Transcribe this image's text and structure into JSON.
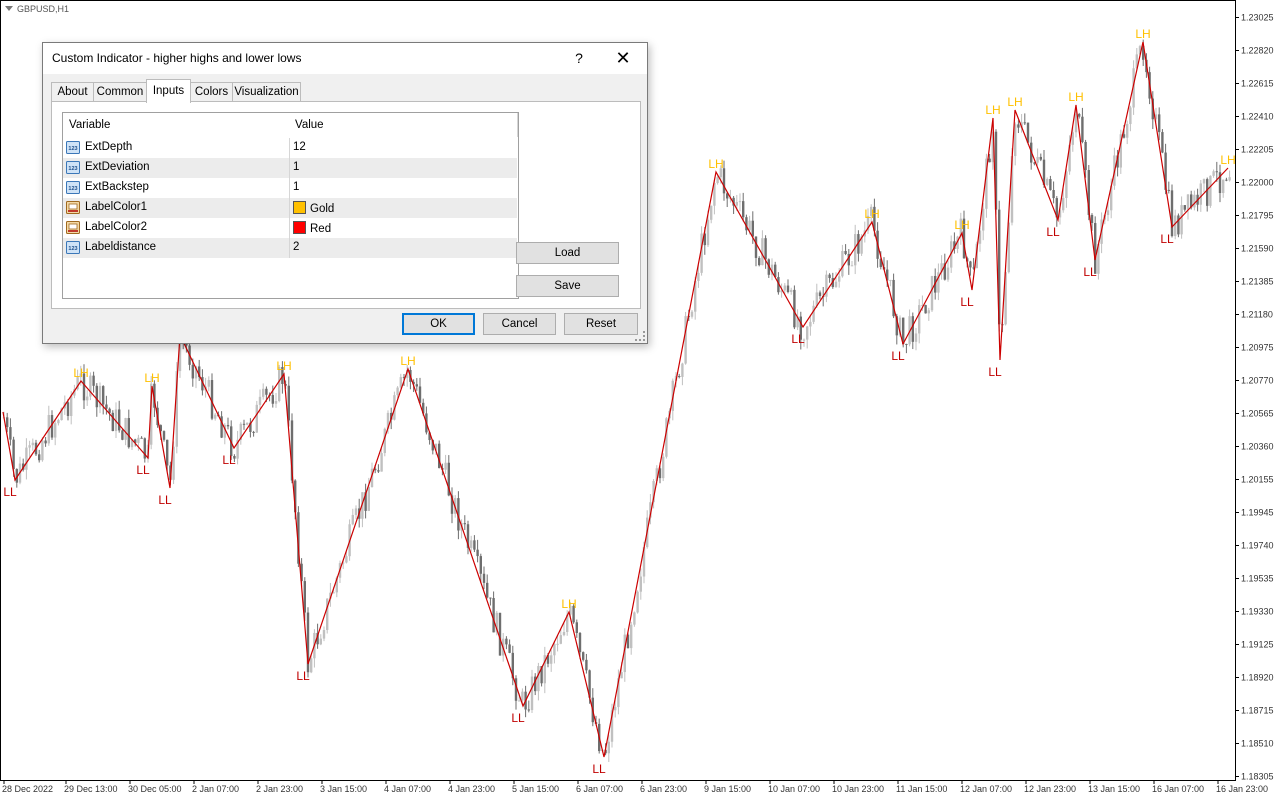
{
  "chart": {
    "symbol": "GBPUSD,H1",
    "price_levels": [
      "1.23025",
      "1.22820",
      "1.22615",
      "1.22410",
      "1.22205",
      "1.22000",
      "1.21795",
      "1.21590",
      "1.21385",
      "1.21180",
      "1.20975",
      "1.20770",
      "1.20565",
      "1.20360",
      "1.20155",
      "1.19945",
      "1.19740",
      "1.19535",
      "1.19330",
      "1.19125",
      "1.18920",
      "1.18715",
      "1.18510",
      "1.18305"
    ],
    "time_labels": [
      "28 Dec 2022",
      "29 Dec 13:00",
      "30 Dec 05:00",
      "2 Jan 07:00",
      "2 Jan 23:00",
      "3 Jan 15:00",
      "4 Jan 07:00",
      "4 Jan 23:00",
      "5 Jan 15:00",
      "6 Jan 07:00",
      "6 Jan 23:00",
      "9 Jan 15:00",
      "10 Jan 07:00",
      "10 Jan 23:00",
      "11 Jan 15:00",
      "12 Jan 07:00",
      "12 Jan 23:00",
      "13 Jan 15:00",
      "16 Jan 07:00",
      "16 Jan 23:00"
    ],
    "high_label": "LH",
    "low_label": "LL",
    "colors": {
      "high_label": "#ffc000",
      "low_label": "#c00000",
      "zigzag": "#cc0000",
      "bull_candle": "#c0c0c0",
      "bear_candle": "#6e6e6e"
    }
  },
  "dialog": {
    "title": "Custom Indicator - higher highs and lower lows",
    "help": "?",
    "close": "✕",
    "tabs": [
      {
        "label": "About",
        "active": false
      },
      {
        "label": "Common",
        "active": false
      },
      {
        "label": "Inputs",
        "active": true
      },
      {
        "label": "Colors",
        "active": false
      },
      {
        "label": "Visualization",
        "active": false
      }
    ],
    "grid": {
      "headers": {
        "variable": "Variable",
        "value": "Value"
      },
      "rows": [
        {
          "variable": "ExtDepth",
          "value": "12",
          "icon": "number-icon"
        },
        {
          "variable": "ExtDeviation",
          "value": "1",
          "icon": "number-icon"
        },
        {
          "variable": "ExtBackstep",
          "value": "1",
          "icon": "number-icon"
        },
        {
          "variable": "LabelColor1",
          "value": "Gold",
          "icon": "color-icon",
          "swatch": "#ffc000"
        },
        {
          "variable": "LabelColor2",
          "value": "Red",
          "icon": "color-icon",
          "swatch": "#ff0000"
        },
        {
          "variable": "Labeldistance",
          "value": "2",
          "icon": "number-icon"
        }
      ]
    },
    "buttons": {
      "load": "Load",
      "save": "Save",
      "ok": "OK",
      "cancel": "Cancel",
      "reset": "Reset"
    }
  }
}
